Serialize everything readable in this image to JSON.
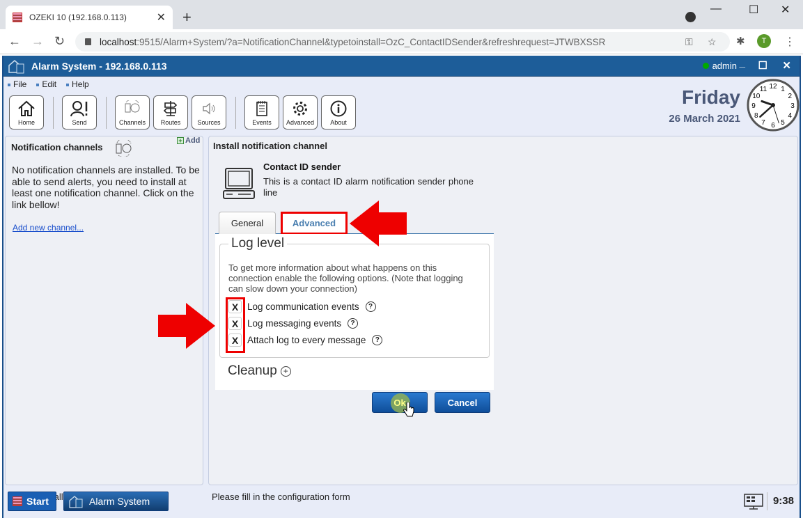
{
  "browser": {
    "tab_title": "OZEKI 10 (192.168.0.113)",
    "url_host": "localhost",
    "url_rest": ":9515/Alarm+System/?a=NotificationChannel&typetoinstall=OzC_ContactIDSender&refreshrequest=JTWBXSSR",
    "profile_initial": "T"
  },
  "app": {
    "title": "Alarm System - 192.168.0.113",
    "user": "admin",
    "status_color": "#00aa00",
    "menu": [
      "File",
      "Edit",
      "Help"
    ],
    "toolbar": [
      {
        "id": "home",
        "label": "Home"
      },
      {
        "id": "send",
        "label": "Send"
      },
      {
        "id": "channels",
        "label": "Channels"
      },
      {
        "id": "routes",
        "label": "Routes"
      },
      {
        "id": "sources",
        "label": "Sources"
      },
      {
        "id": "events",
        "label": "Events"
      },
      {
        "id": "advanced",
        "label": "Advanced"
      },
      {
        "id": "about",
        "label": "About"
      }
    ],
    "day": "Friday",
    "date": "26 March 2021",
    "clock": {
      "hour": 9,
      "minute": 38,
      "second": 27
    }
  },
  "left_panel": {
    "title": "Notification channels",
    "add_label": "Add",
    "message": "No notification channels are installed. To be able to send alerts, you need to install at least one notification channel. Click on the link bellow!",
    "link": "Add new channel...",
    "footer": "Please install a channel!"
  },
  "right_panel": {
    "title": "Install notification channel",
    "device_title": "Contact ID sender",
    "device_desc": "This is a contact ID alarm notification sender phone line",
    "tabs": [
      {
        "label": "General",
        "active": false
      },
      {
        "label": "Advanced",
        "active": true
      }
    ],
    "log_level": {
      "legend": "Log level",
      "description": "To get more information about what happens on this connection enable the following options. (Note that logging can slow down your connection)",
      "options": [
        {
          "label": "Log communication events",
          "checked": true,
          "mark": "X"
        },
        {
          "label": "Log messaging events",
          "checked": true,
          "mark": "X"
        },
        {
          "label": "Attach log to every message",
          "checked": true,
          "mark": "X"
        }
      ],
      "help": "?"
    },
    "cleanup": "Cleanup",
    "ok_label": "Ok",
    "cancel_label": "Cancel",
    "footer": "Please fill in the configuration form"
  },
  "taskbar": {
    "start": "Start",
    "task": "Alarm System",
    "time": "9:38"
  },
  "highlight_color": "#ee0000"
}
